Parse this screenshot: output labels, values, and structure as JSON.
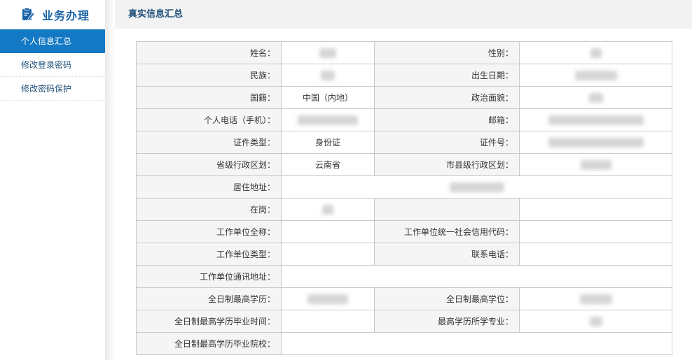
{
  "sidebar": {
    "title": "业务办理",
    "items": [
      {
        "label": "个人信息汇总",
        "active": true
      },
      {
        "label": "修改登录密码",
        "active": false
      },
      {
        "label": "修改密码保护",
        "active": false
      }
    ]
  },
  "header": {
    "title": "真实信息汇总"
  },
  "form": {
    "name_label": "姓名：",
    "gender_label": "性别：",
    "ethnicity_label": "民族：",
    "birthdate_label": "出生日期：",
    "nationality_label": "国籍：",
    "nationality_value": "中国（内地）",
    "political_status_label": "政治面貌：",
    "phone_label": "个人电话（手机）：",
    "email_label": "邮箱：",
    "id_type_label": "证件类型：",
    "id_type_value": "身份证",
    "id_number_label": "证件号：",
    "province_label": "省级行政区划：",
    "province_value": "云南省",
    "city_label": "市县级行政区划：",
    "address_label": "居住地址：",
    "employed_label": "在岗：",
    "employer_name_label": "工作单位全称：",
    "credit_code_label": "工作单位统一社会信用代码：",
    "employer_type_label": "工作单位类型：",
    "contact_phone_label": "联系电话：",
    "employer_address_label": "工作单位通讯地址：",
    "highest_education_label": "全日制最高学历：",
    "highest_degree_label": "全日制最高学位：",
    "graduation_time_label": "全日制最高学历毕业时间：",
    "major_label": "最高学历所学专业：",
    "school_label": "全日制最高学历毕业院校："
  },
  "colors": {
    "accent": "#1479c4",
    "brand": "#1a63a8",
    "label_bg": "#f5f5f5",
    "border": "#c8c8c8"
  }
}
